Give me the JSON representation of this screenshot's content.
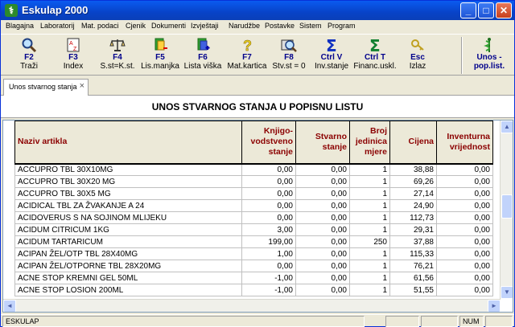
{
  "window": {
    "title": "Eskulap 2000",
    "app_icon": "caduceus-icon"
  },
  "menu": [
    "Blagajna",
    "Laboratorij",
    "Mat. podaci",
    "Cjenik",
    "Dokumenti",
    "Izvještaji",
    "Narudžbe",
    "Postavke",
    "Sistem",
    "Program"
  ],
  "toolbar": [
    {
      "key": "F2",
      "label": "Traži",
      "icon": "search-icon"
    },
    {
      "key": "F3",
      "label": "Index",
      "icon": "sort-az-icon"
    },
    {
      "key": "F4",
      "label": "S.st=K.st.",
      "icon": "scales-icon"
    },
    {
      "key": "F5",
      "label": "Lis.manjka",
      "icon": "document-minus-icon"
    },
    {
      "key": "F6",
      "label": "Lista viška",
      "icon": "document-plus-icon"
    },
    {
      "key": "F7",
      "label": "Mat.kartica",
      "icon": "help-icon"
    },
    {
      "key": "F8",
      "label": "Stv.st = 0",
      "icon": "film-search-icon"
    },
    {
      "key": "Ctrl V",
      "label": "Inv.stanje",
      "icon": "sum-blue-icon"
    },
    {
      "key": "Ctrl T",
      "label": "Financ.uskl.",
      "icon": "sum-green-icon"
    },
    {
      "key": "Esc",
      "label": "Izlaz",
      "icon": "exit-key-icon"
    },
    {
      "key": "Unos -",
      "label": "pop.list.",
      "icon": "caduceus-icon"
    }
  ],
  "tab": {
    "label": "Unos stvarnog stanja"
  },
  "heading": "UNOS STVARNOG STANJA U POPISNU LISTU",
  "table": {
    "columns": [
      "Naziv artikla",
      "Knjigo- vodstveno stanje",
      "Stvarno stanje",
      "Broj jedinica mjere",
      "Cijena",
      "Inventurna vrijednost"
    ],
    "rows": [
      [
        "ACCUPRO TBL 30X10MG",
        "0,00",
        "0,00",
        "1",
        "38,88",
        "0,00"
      ],
      [
        "ACCUPRO TBL 30X20 MG",
        "0,00",
        "0,00",
        "1",
        "69,26",
        "0,00"
      ],
      [
        "ACCUPRO TBL 30X5 MG",
        "0,00",
        "0,00",
        "1",
        "27,14",
        "0,00"
      ],
      [
        "ACIDICAL TBL ZA ŽVAKANJE A 24",
        "0,00",
        "0,00",
        "1",
        "24,90",
        "0,00"
      ],
      [
        "ACIDOVERUS S NA SOJINOM MLIJEKU",
        "0,00",
        "0,00",
        "1",
        "112,73",
        "0,00"
      ],
      [
        "ACIDUM CITRICUM 1KG",
        "3,00",
        "0,00",
        "1",
        "29,31",
        "0,00"
      ],
      [
        "ACIDUM TARTARICUM",
        "199,00",
        "0,00",
        "250",
        "37,88",
        "0,00"
      ],
      [
        "ACIPAN ŽEL/OTP TBL 28X40MG",
        "1,00",
        "0,00",
        "1",
        "115,33",
        "0,00"
      ],
      [
        "ACIPAN ŽEL/OTPORNE TBL 28X20MG",
        "0,00",
        "0,00",
        "1",
        "76,21",
        "0,00"
      ],
      [
        "ACNE STOP KREMNI GEL 50ML",
        "-1,00",
        "0,00",
        "1",
        "61,56",
        "0,00"
      ],
      [
        "ACNE STOP LOSION 200ML",
        "-1,00",
        "0,00",
        "1",
        "51,55",
        "0,00"
      ]
    ]
  },
  "status": {
    "app": "ESKULAP",
    "num": "NUM"
  }
}
